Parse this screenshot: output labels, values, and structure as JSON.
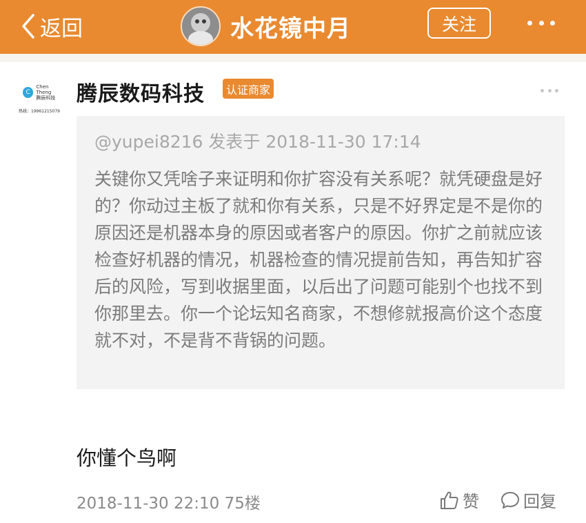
{
  "topbar": {
    "back_label": "返回",
    "title": "水花镜中月",
    "follow_label": "关注"
  },
  "post": {
    "logo_name": "Chen Theng",
    "logo_name_cn": "腾辰科技",
    "logo_phone": "热线：19961215079",
    "author": "腾辰数码科技",
    "badge": "认证商家",
    "quote_meta": "@yupei8216 发表于 2018-11-30 17:14",
    "quote_text": "关键你又凭啥子来证明和你扩容没有关系呢？就凭硬盘是好的？你动过主板了就和你有关系，只是不好界定是不是你的原因还是机器本身的原因或者客户的原因。你扩之前就应该检查好机器的情况，机器检查的情况提前告知，再告知扩容后的风险，写到收据里面，以后出了问题可能别个也找不到你那里去。你一个论坛知名商家，不想修就报高价这个态度就不对，不是背不背锅的问题。",
    "reply_text": "你懂个鸟啊",
    "timestamp": "2018-11-30 22:10",
    "floor": "75楼",
    "like_label": "赞",
    "reply_label": "回复"
  },
  "colors": {
    "accent": "#e98a30",
    "quote_bg": "#f3f3f3",
    "logo_blue": "#31a7dd"
  },
  "icons": [
    "chevron-left-icon",
    "more-icon",
    "thumb-up-icon",
    "comment-icon"
  ]
}
